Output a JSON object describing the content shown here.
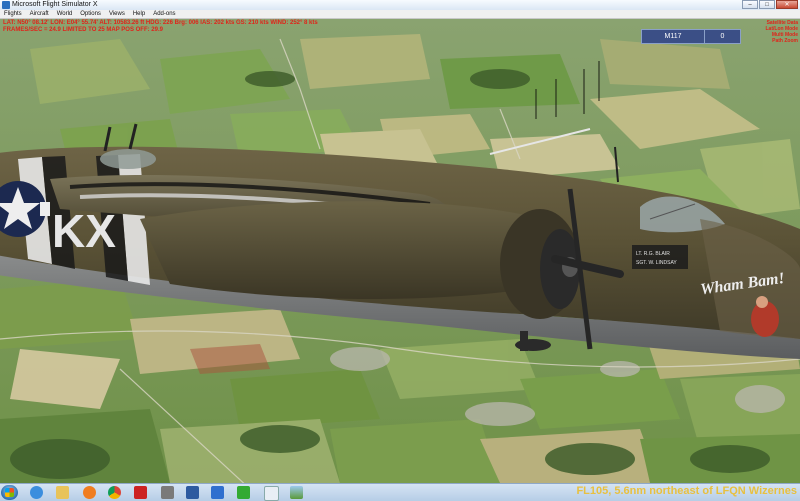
{
  "window": {
    "title": "Microsoft Flight Simulator X",
    "buttons": {
      "minimize": "–",
      "maximize": "□",
      "close": "✕"
    }
  },
  "menu": [
    "Flights",
    "Aircraft",
    "World",
    "Options",
    "Views",
    "Help",
    "Add-ons"
  ],
  "status": {
    "line1": "LAT: N50° 08.12'  LON: E04° 55.74'  ALT: 10583.26 ft  HDG: 226  Brg: 006  IAS: 202 kts  GS: 210 kts  WIND: 252° 8 kts",
    "line2": "FRAMES/SEC = 24.9   LIMITED TO 25   MAP POS   OFF: 29.9"
  },
  "side_panel": [
    "Satellite Data",
    "Lat/Lon Mode",
    "Multi Mode",
    "Path Zoom"
  ],
  "target": {
    "id": "M117",
    "value": "0"
  },
  "aircraft": {
    "code_letters": "KX",
    "nose_art": "Wham Bam!",
    "crew_plate_line1": "LT. R.G. BLAIR",
    "crew_plate_line2": "SGT. W. LINDSAY"
  },
  "taskbar": {
    "icons": [
      "start-icon",
      "ie-icon",
      "folder-icon",
      "media-player-icon",
      "chrome-icon",
      "app-icon",
      "app-icon-2",
      "notepad-icon",
      "fsx-icon",
      "game-icon",
      "window-icon",
      "landscape-icon"
    ]
  },
  "location_text": "FL105, 5.6nm northeast of LFQN Wizernes",
  "colors": {
    "status_text": "#e0241a",
    "location_text": "#e8c040",
    "target_box": "#3b4f86"
  }
}
